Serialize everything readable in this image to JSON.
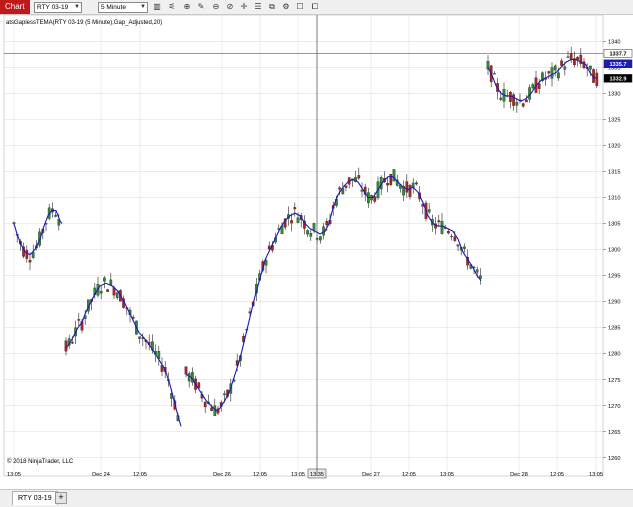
{
  "window": {
    "title": "Chart"
  },
  "toolbar": {
    "instrument_value": "RTY 03-19",
    "interval_value": "5 Minute",
    "icons": [
      "bar-type-icon",
      "data-series-icon",
      "zoom-in-icon",
      "drawing-tools-icon",
      "zoom-out-icon",
      "zoom-reset-icon",
      "crosshair-icon",
      "properties-icon",
      "indicators-icon",
      "strategies-icon",
      "chart-trader-icon",
      "snapshot-icon"
    ]
  },
  "footer": {
    "instrument_tab": "RTY 03-19",
    "add_tab": "+"
  },
  "chart_data": {
    "type": "candlestick",
    "indicator_label": "atsGaplessTEMA(RTY 03-19 (5 Minute),Gap_Adjusted,20)",
    "copyright": "© 2018 NinjaTrader, LLC",
    "y_ticks": [
      1260,
      1265,
      1270,
      1275,
      1280,
      1285,
      1290,
      1295,
      1300,
      1305,
      1310,
      1315,
      1320,
      1325,
      1330,
      1335,
      1340
    ],
    "ylim": [
      1258,
      1342
    ],
    "x_ticks": [
      "13:05",
      "Dec 24",
      "12:05",
      "Dec 26",
      "12:05",
      "13:05",
      "13:35",
      "Dec 27",
      "12:05",
      "13:05",
      "Dec 28",
      "12:05",
      "13:05"
    ],
    "crosshair_time": "13:35",
    "crosshair_price": "1337.7",
    "markers": [
      {
        "value": "1337.7",
        "color": "#ffffff",
        "text_color": "#000000"
      },
      {
        "value": "1335.7",
        "color": "#1a1ab8",
        "text_color": "#ffffff"
      },
      {
        "value": "1332.9",
        "color": "#000000",
        "text_color": "#ffffff"
      }
    ],
    "colors": {
      "up": "#2e8b2e",
      "down": "#b22222",
      "line": "#1a1ab8",
      "grid": "#d8d8d8"
    },
    "tema_segments": [
      [
        [
          14,
          1305
        ],
        [
          17,
          1303
        ],
        [
          21,
          1301
        ],
        [
          25,
          1299.5
        ],
        [
          30,
          1299
        ],
        [
          35,
          1300
        ],
        [
          40,
          1302
        ],
        [
          44,
          1304.5
        ],
        [
          48,
          1306.5
        ],
        [
          52,
          1307.5
        ],
        [
          56,
          1307.5
        ],
        [
          60,
          1305.5
        ],
        [
          62,
          1305
        ]
      ],
      [
        [
          66,
          1281
        ],
        [
          70,
          1282
        ],
        [
          74,
          1283.5
        ],
        [
          78,
          1285
        ],
        [
          82,
          1286
        ],
        [
          86,
          1288
        ],
        [
          90,
          1289.5
        ],
        [
          95,
          1291.5
        ],
        [
          100,
          1293
        ],
        [
          106,
          1293.5
        ],
        [
          112,
          1293
        ],
        [
          118,
          1292
        ],
        [
          124,
          1290
        ],
        [
          129,
          1288
        ],
        [
          134,
          1286
        ],
        [
          139,
          1284
        ],
        [
          144,
          1283
        ],
        [
          150,
          1281.5
        ],
        [
          155,
          1280
        ],
        [
          160,
          1278.5
        ],
        [
          165,
          1277
        ],
        [
          170,
          1274
        ],
        [
          174,
          1271
        ],
        [
          178,
          1268
        ],
        [
          181,
          1266
        ]
      ],
      [
        [
          186,
          1276
        ],
        [
          191,
          1275.5
        ],
        [
          196,
          1274
        ],
        [
          201,
          1272.5
        ],
        [
          206,
          1271
        ],
        [
          211,
          1270
        ],
        [
          216,
          1269
        ],
        [
          220,
          1269.5
        ],
        [
          225,
          1271
        ],
        [
          230,
          1273
        ],
        [
          235,
          1276
        ],
        [
          240,
          1279
        ],
        [
          245,
          1283
        ],
        [
          250,
          1287
        ],
        [
          255,
          1291
        ],
        [
          260,
          1294.5
        ],
        [
          265,
          1298
        ],
        [
          270,
          1300
        ],
        [
          275,
          1302
        ],
        [
          280,
          1304
        ],
        [
          285,
          1305.5
        ],
        [
          290,
          1306.5
        ],
        [
          295,
          1307
        ],
        [
          300,
          1306.5
        ],
        [
          305,
          1305
        ],
        [
          310,
          1304
        ],
        [
          315,
          1303.5
        ],
        [
          320,
          1303
        ],
        [
          325,
          1303.5
        ],
        [
          329,
          1305
        ],
        [
          333,
          1308
        ],
        [
          338,
          1310.5
        ],
        [
          343,
          1312
        ],
        [
          348,
          1313
        ],
        [
          353,
          1313.5
        ],
        [
          358,
          1313
        ],
        [
          363,
          1311.5
        ],
        [
          368,
          1310
        ],
        [
          373,
          1310
        ],
        [
          378,
          1311.5
        ],
        [
          383,
          1313
        ],
        [
          388,
          1314
        ],
        [
          393,
          1314
        ],
        [
          398,
          1313
        ],
        [
          403,
          1312
        ],
        [
          408,
          1311.5
        ],
        [
          413,
          1312
        ],
        [
          418,
          1311
        ],
        [
          423,
          1309
        ],
        [
          428,
          1306.5
        ],
        [
          433,
          1305
        ],
        [
          438,
          1304.5
        ],
        [
          443,
          1304.5
        ],
        [
          448,
          1304
        ],
        [
          453,
          1303.5
        ],
        [
          458,
          1302
        ],
        [
          463,
          1299.5
        ],
        [
          468,
          1298
        ],
        [
          473,
          1296.5
        ],
        [
          477,
          1295
        ],
        [
          481,
          1294
        ]
      ],
      [
        [
          488,
          1335
        ],
        [
          492,
          1333.5
        ],
        [
          496,
          1331.5
        ],
        [
          501,
          1330
        ],
        [
          506,
          1329.5
        ],
        [
          511,
          1329.5
        ],
        [
          516,
          1329
        ],
        [
          521,
          1328.5
        ],
        [
          526,
          1329
        ],
        [
          531,
          1330
        ],
        [
          536,
          1331.5
        ],
        [
          541,
          1332.5
        ],
        [
          546,
          1333
        ],
        [
          551,
          1333.5
        ],
        [
          556,
          1334
        ],
        [
          561,
          1335
        ],
        [
          566,
          1336
        ],
        [
          571,
          1336.5
        ],
        [
          576,
          1336.5
        ],
        [
          581,
          1336
        ],
        [
          586,
          1335.5
        ],
        [
          590,
          1334
        ],
        [
          594,
          1333
        ],
        [
          597,
          1333
        ]
      ]
    ]
  }
}
